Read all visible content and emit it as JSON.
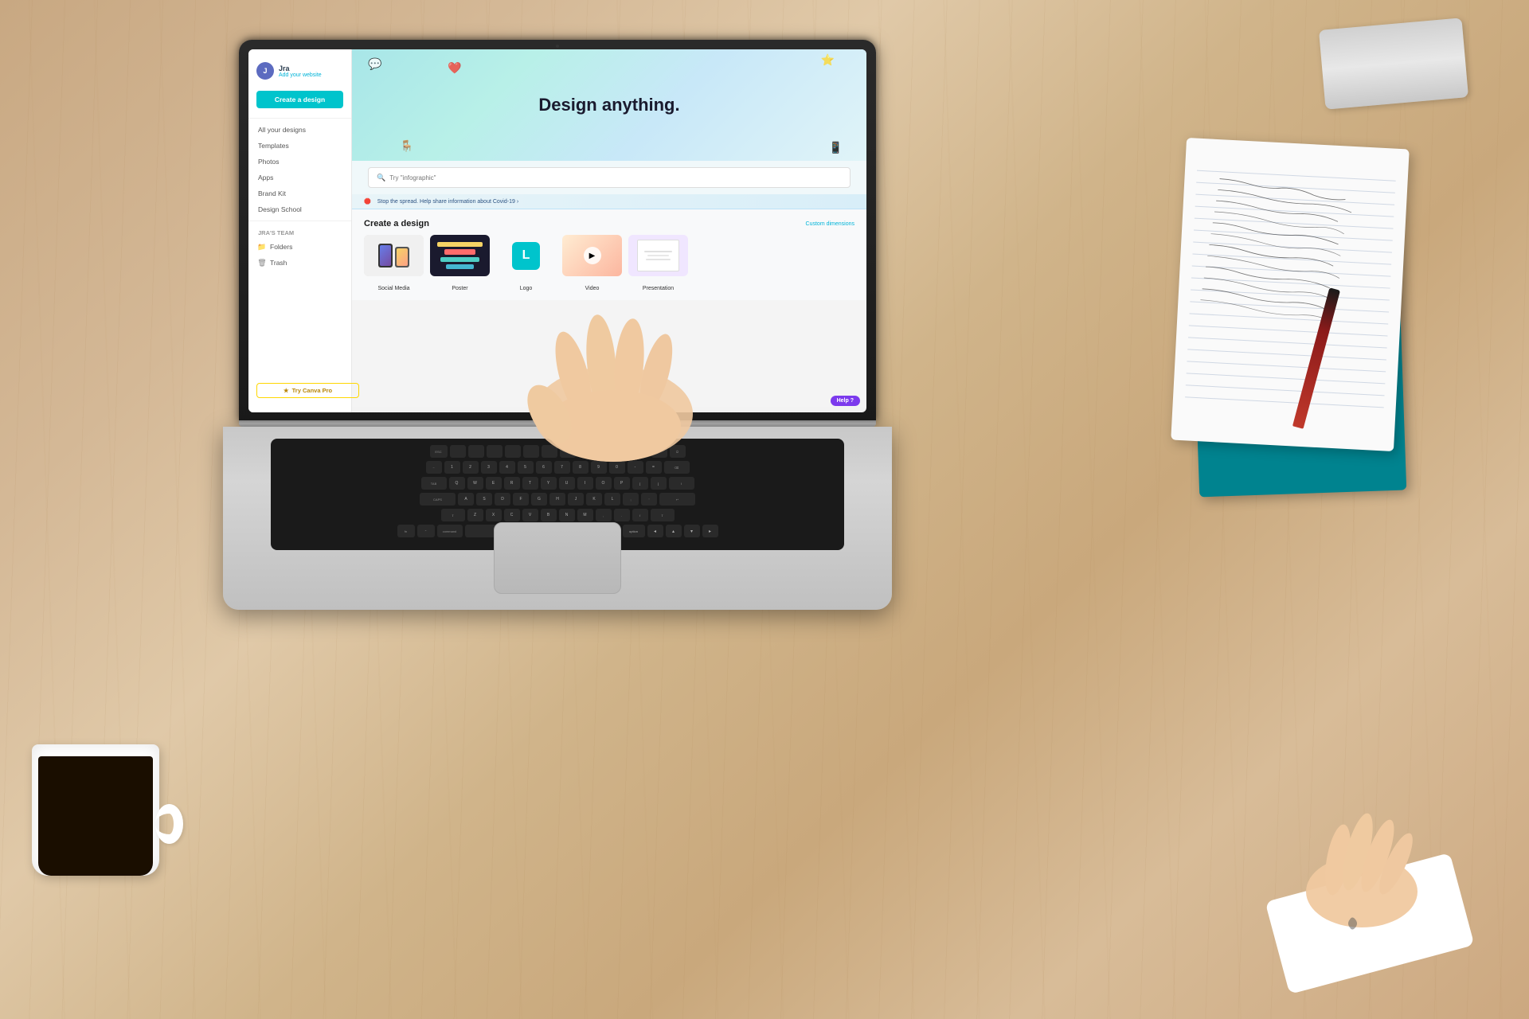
{
  "scene": {
    "description": "Overhead view of wooden desk with MacBook running Canva, coffee cup, notebooks, pen"
  },
  "canva": {
    "sidebar": {
      "user": {
        "name": "Jra",
        "avatar_initials": "J",
        "link_text": "Add your website"
      },
      "create_button": "Create a design",
      "items": [
        {
          "label": "All your designs",
          "icon": "grid-icon"
        },
        {
          "label": "Templates",
          "icon": "template-icon"
        },
        {
          "label": "Photos",
          "icon": "photo-icon"
        },
        {
          "label": "Apps",
          "icon": "apps-icon"
        },
        {
          "label": "Brand Kit",
          "icon": "brand-icon"
        },
        {
          "label": "Design School",
          "icon": "school-icon"
        }
      ],
      "team_section": "Jra's team",
      "team_items": [
        {
          "label": "Folders",
          "icon": "folder-icon"
        },
        {
          "label": "Trash",
          "icon": "trash-icon"
        }
      ],
      "pro_button": "Try Canva Pro"
    },
    "hero": {
      "title": "Design anything.",
      "search_placeholder": "Try \"infographic\""
    },
    "covid_banner": {
      "text": "Stop the spread. Help share information about Covid-19 ›"
    },
    "create_section": {
      "title": "Create a design",
      "custom_dimensions": "Custom dimensions",
      "options": [
        {
          "label": "Social Media",
          "type": "social"
        },
        {
          "label": "Poster",
          "type": "poster"
        },
        {
          "label": "Logo",
          "type": "logo"
        },
        {
          "label": "Video",
          "type": "video"
        },
        {
          "label": "Presentation",
          "type": "presentation"
        }
      ]
    },
    "help_button": "Help ?",
    "keyboard_key": "option"
  },
  "desk_items": {
    "coffee_cup": "white ceramic mug with black coffee",
    "notebooks": [
      "teal spiral notebook",
      "white notepad with handwriting"
    ],
    "pen": "dark red pen",
    "silver_item": "silver laptop or tablet"
  }
}
